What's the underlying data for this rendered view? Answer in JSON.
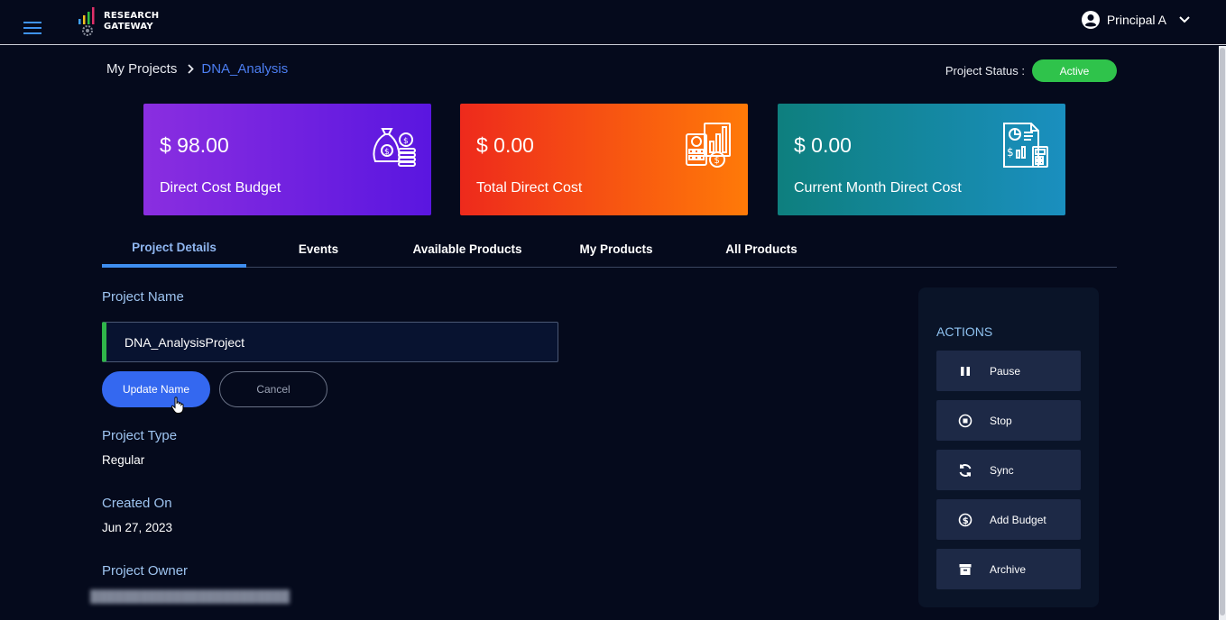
{
  "app": {
    "logo_line1": "RESEARCH",
    "logo_line2": "GATEWAY"
  },
  "user": {
    "name": "Principal A"
  },
  "breadcrumb": {
    "home": "My Projects",
    "current": "DNA_Analysis"
  },
  "status": {
    "label": "Project Status :",
    "value": "Active",
    "color": "#2fc34b"
  },
  "cards": [
    {
      "value": "$ 98.00",
      "label": "Direct Cost Budget",
      "icon": "money-bag-icon"
    },
    {
      "value": "$ 0.00",
      "label": "Total Direct Cost",
      "icon": "calculator-chart-icon"
    },
    {
      "value": "$ 0.00",
      "label": "Current Month Direct Cost",
      "icon": "report-icon"
    }
  ],
  "tabs": [
    {
      "label": "Project Details",
      "active": true
    },
    {
      "label": "Events"
    },
    {
      "label": "Available Products"
    },
    {
      "label": "My Products"
    },
    {
      "label": "All Products"
    }
  ],
  "details": {
    "name_label": "Project Name",
    "name_value": "DNA_AnalysisProject",
    "update_button": "Update Name",
    "cancel_button": "Cancel",
    "type_label": "Project Type",
    "type_value": "Regular",
    "created_label": "Created On",
    "created_value": "Jun 27, 2023",
    "owner_label": "Project Owner"
  },
  "actions": {
    "title": "ACTIONS",
    "items": [
      {
        "label": "Pause",
        "icon": "pause-icon"
      },
      {
        "label": "Stop",
        "icon": "stop-icon"
      },
      {
        "label": "Sync",
        "icon": "sync-icon"
      },
      {
        "label": "Add Budget",
        "icon": "dollar-icon"
      },
      {
        "label": "Archive",
        "icon": "archive-icon"
      }
    ]
  },
  "colors": {
    "accent": "#3468f0",
    "link": "#4c7ef2",
    "background": "#050a1c"
  }
}
